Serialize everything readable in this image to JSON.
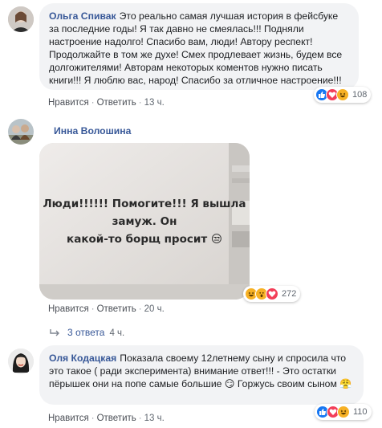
{
  "comments": [
    {
      "author": "Ольга Спивак",
      "text": "Это реально самая лучшая история в фейсбуке за последние годы! Я так давно не смеялась!!! Подняли настроение надолго! Спасибо вам, люди! Автору респект! Продолжайте в том же духе! Смех продлевает жизнь, будем все долгожителями! Авторам некоторых коментов нужно писать книги!!! Я люблю вас, народ! Спасибо за отличное настроение!!!",
      "like": "Нравится",
      "reply": "Ответить",
      "time": "13 ч.",
      "reactions_count": "108",
      "reaction_icons": [
        "like-icon",
        "love-icon",
        "haha-icon"
      ]
    },
    {
      "author": "Инна Волошина",
      "photo_caption_line1": "Люди!!!!!! Помогите!!! Я вышла замуж. Он",
      "photo_caption_line2": "какой-то борщ просит 😒",
      "like": "Нравится",
      "reply": "Ответить",
      "time": "20 ч.",
      "reactions_count": "272",
      "reaction_icons": [
        "haha-icon",
        "wow-icon",
        "love-icon"
      ],
      "replies_label": "3 ответа",
      "replies_time": "4 ч."
    },
    {
      "author": "Оля Кодацкая",
      "text": "Показала своему 12летнему сыну и спросила что это такое ( ради эксперимента) внимание ответ!!! - Это остатки пёрышек они на попе самые большие 😏 Горжусь своим сыном 😤",
      "like": "Нравится",
      "reply": "Ответить",
      "time": "13 ч.",
      "reactions_count": "110",
      "reaction_icons": [
        "like-icon",
        "love-icon",
        "haha-icon"
      ]
    }
  ],
  "colors": {
    "author": "#385898",
    "bubble": "#f2f3f5",
    "like": "#1877f2",
    "love": "#f33e58",
    "haha": "#f7b125"
  }
}
